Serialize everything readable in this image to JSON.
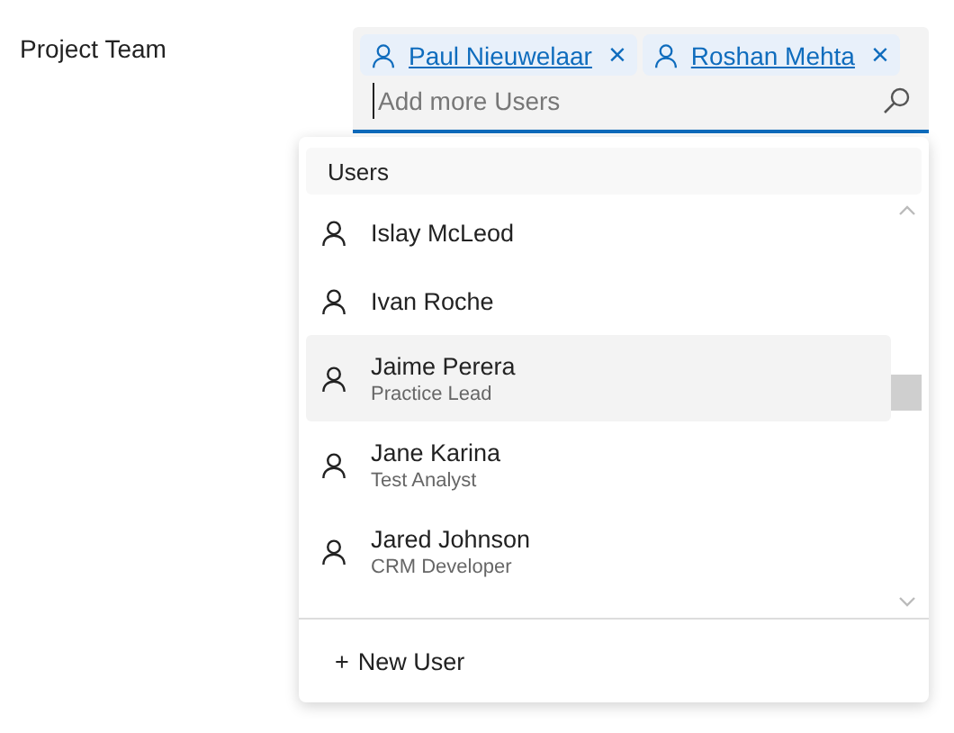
{
  "field_label": "Project Team",
  "selected_users": [
    {
      "name": "Paul Nieuwelaar",
      "remove": "×"
    },
    {
      "name": "Roshan Mehta",
      "remove": "×"
    }
  ],
  "search": {
    "placeholder": "Add more Users"
  },
  "dropdown": {
    "header": "Users",
    "items": [
      {
        "name": "Islay McLeod",
        "highlighted": false
      },
      {
        "name": "Ivan Roche",
        "highlighted": false
      },
      {
        "name": "Jaime Perera",
        "subtitle": "Practice Lead",
        "highlighted": true
      },
      {
        "name": "Jane Karina",
        "subtitle": "Test Analyst",
        "highlighted": false
      },
      {
        "name": "Jared Johnson",
        "subtitle": "CRM Developer",
        "highlighted": false
      }
    ],
    "new_button": {
      "icon": "+",
      "label": "New User"
    }
  }
}
